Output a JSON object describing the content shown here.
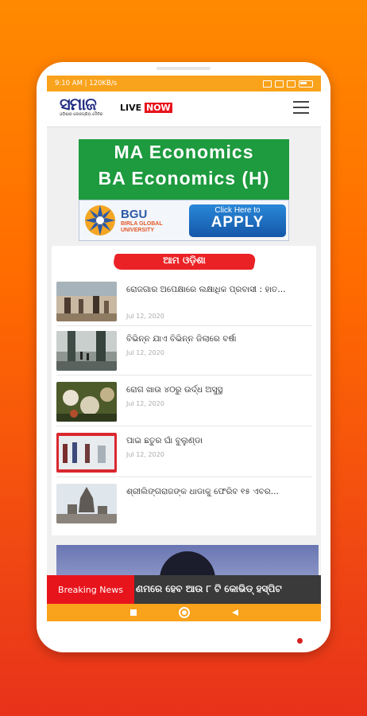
{
  "status_bar": {
    "left_text": "9:10 AM | 120KB/s"
  },
  "app": {
    "logo_text": "ସମାଜ",
    "logo_tagline": "ଓଡ଼ିଶାର ଲୋକପ୍ରିୟ ଦୈନିକ",
    "live_text": "LIVE",
    "now_text": "NOW"
  },
  "ad": {
    "line1": "MA Economics",
    "line2": "BA Economics (H)",
    "org_short": "BGU",
    "org_full_1": "BIRLA GLOBAL",
    "org_full_2": "UNIVERSITY",
    "cta_small": "Click Here to",
    "cta_big": "APPLY"
  },
  "section": {
    "title": "ଆମ ଓଡ଼ିଶା"
  },
  "news": [
    {
      "headline": "ରୋଜଗାର ଅପେକ୍ଷାରେ ଲକ୍ଷାଧିକ ପ୍ରବାସୀ : ହାତ...",
      "date": "Jul 12, 2020"
    },
    {
      "headline": "ବିଭିନ୍ନ ଯାଏ ବିଭିନ୍ନ ଜିଲାରେ ବର୍ଷା",
      "date": "Jul 12, 2020"
    },
    {
      "headline": "ରୋଗ ଖାଉ ୪୦ରୁ ଉର୍ଦ୍ଧ ଅସୁସ୍ଥ",
      "date": "Jul 12, 2020"
    },
    {
      "headline": "ପାଇ ଛତୁର ଘାଁ ବୁଲୁଣ୍ଡା",
      "date": "Jul 12, 2020"
    },
    {
      "headline": "ଶ୍ରୀଲିଙ୍ଗରାଜଙ୍କ ଧାଡାକୁ ଫେରିବ ୧୫ ଏବର...",
      "date": ""
    }
  ],
  "breaking": {
    "label": "Breaking News",
    "ticker": "ଣମରେ ହେବ ଆଉ ୮ ଟି କୋଭିଡ୍ ହସ୍ପିଟ"
  }
}
